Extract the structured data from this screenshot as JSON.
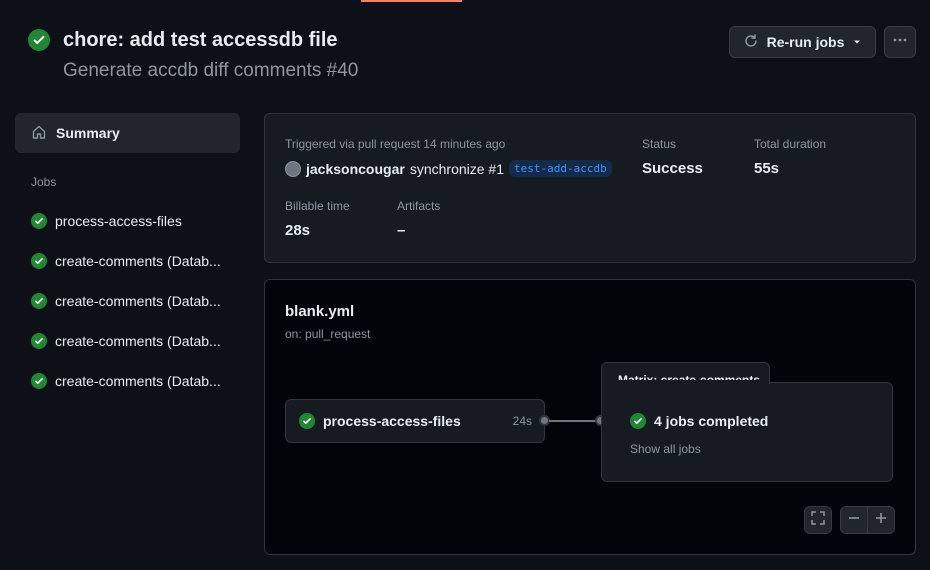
{
  "header": {
    "title": "chore: add test accessdb file",
    "subtitle": "Generate accdb diff comments #40",
    "rerun_label": "Re-run jobs"
  },
  "sidebar": {
    "summary_label": "Summary",
    "jobs_heading": "Jobs",
    "jobs": [
      {
        "label": "process-access-files",
        "status": "success"
      },
      {
        "label": "create-comments (Datab...",
        "status": "success"
      },
      {
        "label": "create-comments (Datab...",
        "status": "success"
      },
      {
        "label": "create-comments (Datab...",
        "status": "success"
      },
      {
        "label": "create-comments (Datab...",
        "status": "success"
      }
    ]
  },
  "summary_card": {
    "triggered_text": "Triggered via pull request 14 minutes ago",
    "actor": "jacksoncougar",
    "action": "synchronize #1",
    "branch": "test-add-accdb",
    "status_label": "Status",
    "status_value": "Success",
    "duration_label": "Total duration",
    "duration_value": "55s",
    "billable_label": "Billable time",
    "billable_value": "28s",
    "artifacts_label": "Artifacts",
    "artifacts_value": "–"
  },
  "graph": {
    "workflow_file": "blank.yml",
    "trigger": "on: pull_request",
    "job_node": {
      "name": "process-access-files",
      "duration": "24s"
    },
    "matrix": {
      "title": "Matrix: create-comments",
      "status": "4 jobs completed",
      "link": "Show all jobs"
    }
  },
  "colors": {
    "success": "#238636",
    "accent": "#f78166",
    "link": "#4493f8",
    "background": "#0d1117"
  }
}
